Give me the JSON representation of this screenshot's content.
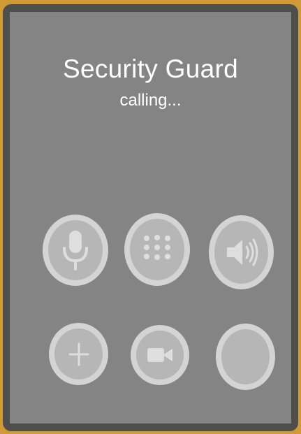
{
  "call": {
    "caller_name": "Security Guard",
    "status": "calling..."
  },
  "controls": [
    {
      "id": "mute",
      "icon": "microphone-icon"
    },
    {
      "id": "keypad",
      "icon": "keypad-icon"
    },
    {
      "id": "speaker",
      "icon": "speaker-icon"
    },
    {
      "id": "add-call",
      "icon": "plus-icon"
    },
    {
      "id": "facetime",
      "icon": "video-camera-icon"
    },
    {
      "id": "extra",
      "icon": ""
    }
  ],
  "colors": {
    "frame_accent": "#d09a36",
    "bezel": "#4f4e4a",
    "screen_background": "#848484",
    "button_fill": "#b6b6b6",
    "button_ring": "#d4d4d4",
    "icon_color": "#dedede",
    "text_color": "#ffffff"
  }
}
